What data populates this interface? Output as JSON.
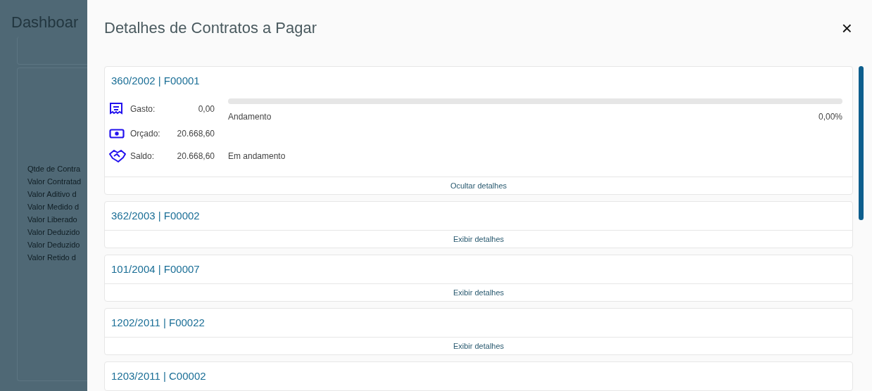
{
  "background": {
    "title": "Dashboar",
    "labels": [
      "Qtde de Contra",
      "Valor Contratad",
      "Valor Aditivo d",
      "Valor Medido d",
      "Valor Liberado",
      "Valor Deduzido",
      "Valor Deduzido",
      "Valor Retido d"
    ]
  },
  "drawer": {
    "title": "Detalhes de Contratos a Pagar",
    "close": "×"
  },
  "contracts": [
    {
      "title": "360/2002 | F00001",
      "expanded": true,
      "toggle": "Ocultar detalhes",
      "details": {
        "rows": [
          {
            "kind": "receipt",
            "label": "Gasto:",
            "value": "0,00"
          },
          {
            "kind": "money",
            "label": "Orçado:",
            "value": "20.668,60"
          },
          {
            "kind": "handshake",
            "label": "Saldo:",
            "value": "20.668,60"
          }
        ],
        "progress": {
          "label": "Andamento",
          "level": 0,
          "reading": "0,00%"
        },
        "status": "Em andamento"
      }
    },
    {
      "title": "362/2003 | F00002",
      "expanded": false,
      "toggle": "Exibir detalhes"
    },
    {
      "title": "101/2004 | F00007",
      "expanded": false,
      "toggle": "Exibir detalhes"
    },
    {
      "title": "1202/2011 | F00022",
      "expanded": false,
      "toggle": "Exibir detalhes"
    },
    {
      "title": "1203/2011 | C00002"
    }
  ]
}
